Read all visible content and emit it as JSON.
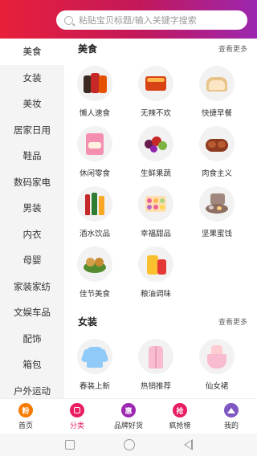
{
  "search": {
    "placeholder": "粘贴宝贝标题/输入关键字搜索",
    "icon": "search-icon"
  },
  "colors": {
    "header_start": "#e8203a",
    "header_end": "#9c27b0",
    "accent": "#e91e63"
  },
  "sidebar": {
    "items": [
      {
        "label": "美食",
        "active": true
      },
      {
        "label": "女装",
        "active": false
      },
      {
        "label": "美妆",
        "active": false
      },
      {
        "label": "居家日用",
        "active": false
      },
      {
        "label": "鞋品",
        "active": false
      },
      {
        "label": "数码家电",
        "active": false
      },
      {
        "label": "男装",
        "active": false
      },
      {
        "label": "内衣",
        "active": false
      },
      {
        "label": "母婴",
        "active": false
      },
      {
        "label": "家装家纺",
        "active": false
      },
      {
        "label": "文娱车品",
        "active": false
      },
      {
        "label": "配饰",
        "active": false
      },
      {
        "label": "箱包",
        "active": false
      },
      {
        "label": "户外运动",
        "active": false
      }
    ]
  },
  "sections": [
    {
      "title": "美食",
      "more": "查看更多",
      "items": [
        {
          "label": "懒人速食",
          "icon": "instant-noodles-icon"
        },
        {
          "label": "无辣不欢",
          "icon": "spicy-snack-icon"
        },
        {
          "label": "快捷早餐",
          "icon": "bread-icon"
        },
        {
          "label": "休闲零食",
          "icon": "snack-pack-icon"
        },
        {
          "label": "生鲜果蔬",
          "icon": "fruit-icon"
        },
        {
          "label": "肉食主义",
          "icon": "meat-icon"
        },
        {
          "label": "酒水饮品",
          "icon": "drinks-icon"
        },
        {
          "label": "幸福甜品",
          "icon": "dessert-icon"
        },
        {
          "label": "坚果蜜饯",
          "icon": "nuts-icon"
        },
        {
          "label": "佳节美食",
          "icon": "mooncake-icon"
        },
        {
          "label": "粮油调味",
          "icon": "cooking-oil-icon"
        }
      ]
    },
    {
      "title": "女装",
      "more": "查看更多",
      "items": [
        {
          "label": "春装上新",
          "icon": "blouse-icon"
        },
        {
          "label": "热销推荐",
          "icon": "coat-icon"
        },
        {
          "label": "仙女裙",
          "icon": "dress-icon"
        }
      ]
    }
  ],
  "tabbar": {
    "tabs": [
      {
        "label": "首页",
        "icon": "home-icon",
        "glyph": "粉",
        "color": "#f57c00",
        "active": false
      },
      {
        "label": "分类",
        "icon": "category-icon",
        "glyph": "",
        "color": "#e91e63",
        "active": true
      },
      {
        "label": "品牌好货",
        "icon": "brand-icon",
        "glyph": "惠",
        "color": "#9c27b0",
        "active": false
      },
      {
        "label": "疯抢榜",
        "icon": "ranking-icon",
        "glyph": "抢",
        "color": "#e91e63",
        "active": false
      },
      {
        "label": "我的",
        "icon": "profile-icon",
        "glyph": "",
        "color": "#7e57c2",
        "active": false
      }
    ]
  }
}
